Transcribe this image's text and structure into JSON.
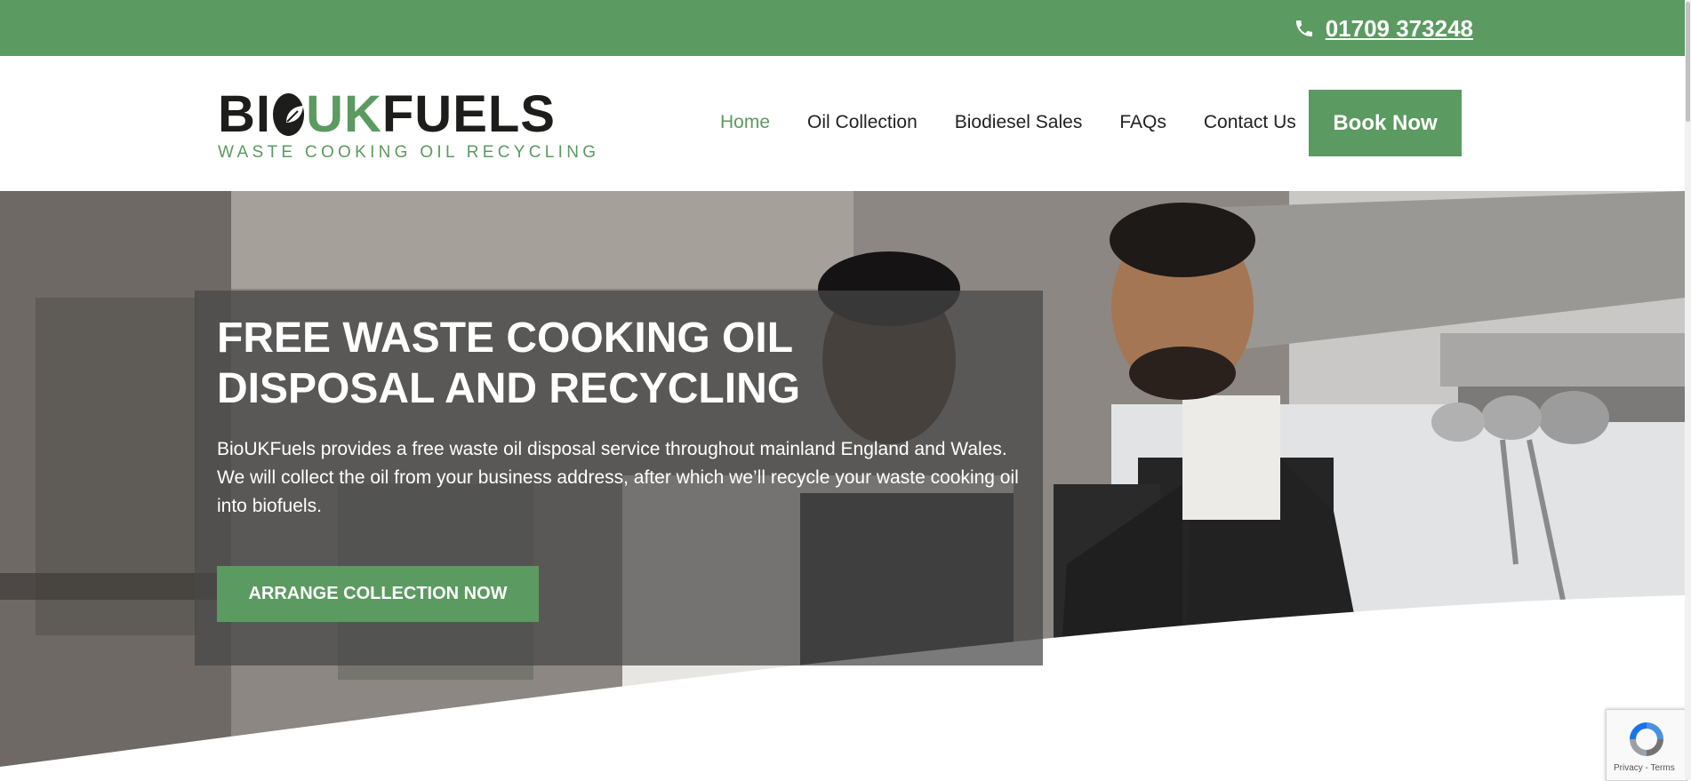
{
  "topbar": {
    "phone": "01709 373248",
    "phone_icon": "phone-icon"
  },
  "logo": {
    "part1": "BI",
    "part2": "UK",
    "part3": "FUELS",
    "tagline": "WASTE COOKING OIL RECYCLING",
    "leaf_icon": "leaf-icon"
  },
  "nav": {
    "items": [
      "Home",
      "Oil Collection",
      "Biodiesel Sales",
      "FAQs",
      "Contact Us"
    ],
    "active": "Home"
  },
  "book_button": "Book Now",
  "hero": {
    "title": "FREE WASTE COOKING OIL DISPOSAL AND RECYCLING",
    "text": "BioUKFuels provides a free waste oil disposal service throughout mainland England and Wales. We will collect the oil from your business address, after which we’ll recycle your waste cooking oil into biofuels.",
    "cta": "ARRANGE COLLECTION NOW"
  },
  "recaptcha": {
    "label": "Privacy - Terms"
  },
  "colors": {
    "brand_green": "#5b9a60",
    "text_dark": "#1d1d1b"
  }
}
